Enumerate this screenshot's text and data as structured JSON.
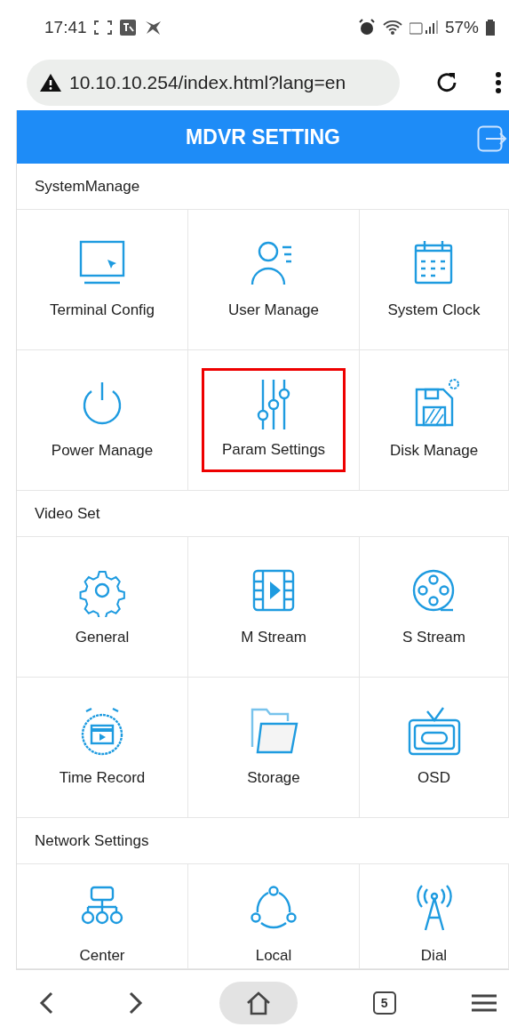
{
  "status_bar": {
    "time": "17:41",
    "battery": "57%"
  },
  "browser": {
    "url": "10.10.10.254/index.html?lang=en"
  },
  "header": {
    "title": "MDVR SETTING"
  },
  "sections": [
    {
      "title": "SystemManage",
      "items": [
        {
          "label": "Terminal Config",
          "highlighted": false
        },
        {
          "label": "User Manage",
          "highlighted": false
        },
        {
          "label": "System Clock",
          "highlighted": false
        },
        {
          "label": "Power Manage",
          "highlighted": false
        },
        {
          "label": "Param Settings",
          "highlighted": true
        },
        {
          "label": "Disk Manage",
          "highlighted": false
        }
      ]
    },
    {
      "title": "Video Set",
      "items": [
        {
          "label": "General",
          "highlighted": false
        },
        {
          "label": "M Stream",
          "highlighted": false
        },
        {
          "label": "S Stream",
          "highlighted": false
        },
        {
          "label": "Time Record",
          "highlighted": false
        },
        {
          "label": "Storage",
          "highlighted": false
        },
        {
          "label": "OSD",
          "highlighted": false
        }
      ]
    },
    {
      "title": "Network Settings",
      "items": [
        {
          "label": "Center",
          "highlighted": false
        },
        {
          "label": "Local",
          "highlighted": false
        },
        {
          "label": "Dial",
          "highlighted": false
        }
      ]
    }
  ],
  "bottom_bar": {
    "tab_count": "5"
  }
}
